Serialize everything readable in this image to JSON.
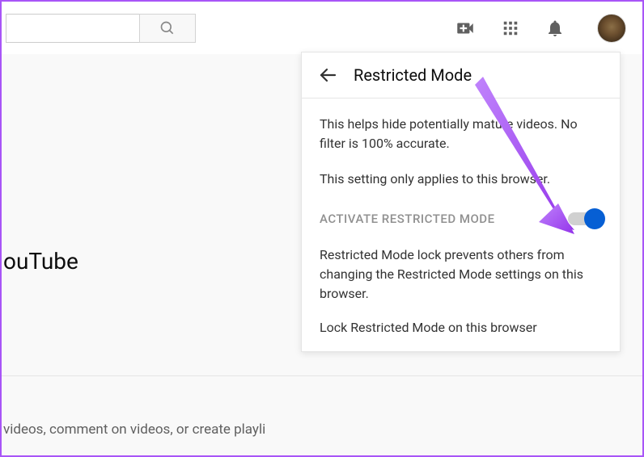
{
  "header": {
    "search_placeholder": "",
    "icons": {
      "search": "search-icon",
      "create": "video-plus-icon",
      "apps": "grid-icon",
      "notifications": "bell-icon",
      "avatar": "avatar"
    }
  },
  "page": {
    "heading": "ouTube",
    "subtext": "videos, comment on videos, or create playli"
  },
  "dropdown": {
    "title": "Restricted Mode",
    "description_1": "This helps hide potentially mature videos. No filter is 100% accurate.",
    "description_2": "This setting only applies to this browser.",
    "toggle_label": "ACTIVATE RESTRICTED MODE",
    "toggle_on": true,
    "lock_description": "Restricted Mode lock prevents others from changing the Restricted Mode settings on this browser.",
    "lock_action": "Lock Restricted Mode on this browser"
  },
  "colors": {
    "accent": "#065fd4",
    "arrow": "#a855f7"
  }
}
